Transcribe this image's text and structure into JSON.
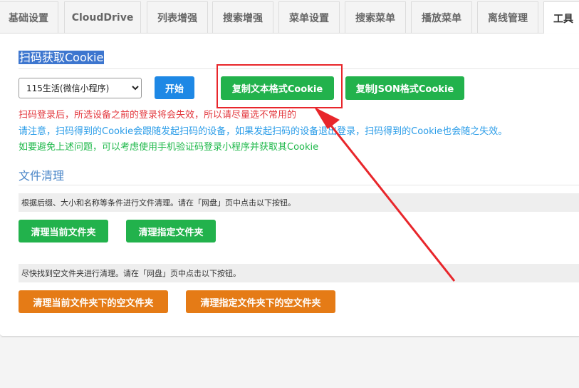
{
  "tabs": [
    {
      "label": "基础设置"
    },
    {
      "label": "CloudDrive"
    },
    {
      "label": "列表增强"
    },
    {
      "label": "搜索增强"
    },
    {
      "label": "菜单设置"
    },
    {
      "label": "搜索菜单"
    },
    {
      "label": "播放菜单"
    },
    {
      "label": "离线管理"
    },
    {
      "label": "工具"
    }
  ],
  "active_tab": "工具",
  "cookie": {
    "title": "扫码获取Cookie",
    "device_options": [
      "115生活(微信小程序)"
    ],
    "device_selected": "115生活(微信小程序)",
    "start_label": "开始",
    "copy_text_label": "复制文本格式Cookie",
    "copy_json_label": "复制JSON格式Cookie",
    "notice_red": "扫码登录后，所选设备之前的登录将会失效，所以请尽量选不常用的",
    "notice_blue": "请注意，扫码得到的Cookie会跟随发起扫码的设备，如果发起扫码的设备退出登录，扫码得到的Cookie也会随之失效。",
    "notice_green": "如要避免上述问题，可以考虑使用手机验证码登录小程序并获取其Cookie"
  },
  "cleanup": {
    "title": "文件清理",
    "desc1": "根据后缀、大小和名称等条件进行文件清理。请在「网盘」页中点击以下按钮。",
    "clean_current_label": "清理当前文件夹",
    "clean_specified_label": "清理指定文件夹",
    "desc2": "尽快找到空文件夹进行清理。请在「网盘」页中点击以下按钮。",
    "clean_current_empty_label": "清理当前文件夹下的空文件夹",
    "clean_specified_empty_label": "清理指定文件夹下的空文件夹"
  },
  "colors": {
    "accent_blue": "#1e88e5",
    "green": "#22b24c",
    "orange": "#e57b16",
    "annotation_red": "#e8262b"
  }
}
